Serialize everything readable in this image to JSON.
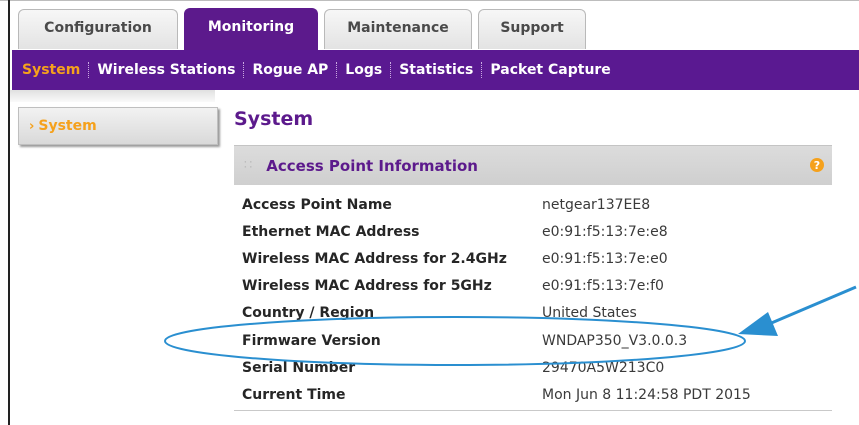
{
  "tabs": [
    "Configuration",
    "Monitoring",
    "Maintenance",
    "Support"
  ],
  "active_tab": "Monitoring",
  "subnav": [
    "System",
    "Wireless Stations",
    "Rogue AP",
    "Logs",
    "Statistics",
    "Packet Capture"
  ],
  "active_subnav": "System",
  "sidebar": {
    "items": [
      {
        "label": "System"
      }
    ]
  },
  "page_title": "System",
  "section": {
    "title": "Access Point Information",
    "help_icon": "?",
    "rows": [
      {
        "label": "Access Point Name",
        "value": "netgear137EE8"
      },
      {
        "label": "Ethernet MAC Address",
        "value": "e0:91:f5:13:7e:e8"
      },
      {
        "label": "Wireless MAC Address for 2.4GHz",
        "value": "e0:91:f5:13:7e:e0"
      },
      {
        "label": "Wireless MAC Address for 5GHz",
        "value": "e0:91:f5:13:7e:f0"
      },
      {
        "label": "Country / Region",
        "value": "United States"
      },
      {
        "label": "Firmware Version",
        "value": "WNDAP350_V3.0.0.3"
      },
      {
        "label": "Serial Number",
        "value": "29470A5W213C0"
      },
      {
        "label": "Current Time",
        "value": "Mon Jun 8 11:24:58 PDT 2015"
      }
    ]
  },
  "colors": {
    "brand_purple": "#5c1a8c",
    "accent_orange": "#f5a11c",
    "callout_blue": "#2a8fd0"
  }
}
